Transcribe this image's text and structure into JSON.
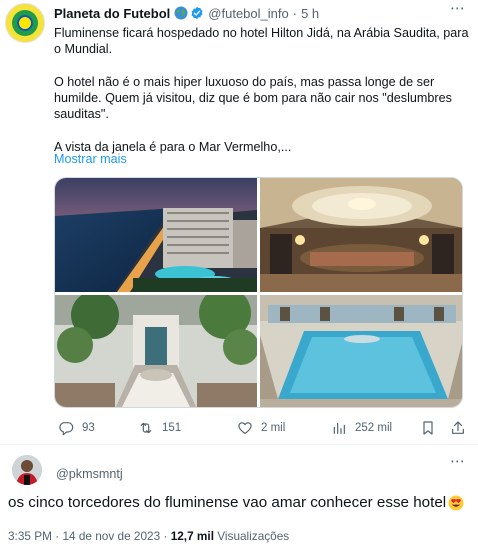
{
  "tweet": {
    "author_name": "Planeta do Futebol",
    "author_handle": "@futebol_info",
    "separator": "·",
    "time": "5 h",
    "paragraphs": [
      "Fluminense ficará hospedado no hotel Hilton Jidá, na Arábia Saudita, para o Mundial.",
      "O hotel não é o mais hiper luxuoso do país, mas passa longe de ser humilde. Quem já visitou, diz que é bom para não cair nos \"deslumbres sauditas\".",
      "A vista da janela é para o Mar Vermelho,..."
    ],
    "show_more": "Mostrar mais",
    "stats": {
      "replies": "93",
      "retweets": "151",
      "likes": "2 mil",
      "views": "252 mil"
    }
  },
  "reply": {
    "handle": "@pkmsmntj",
    "text": "os cinco torcedores do fluminense vao amar conhecer esse hotel",
    "emoji": "smiling-face-with-heart-eyes"
  },
  "meta": {
    "time": "3:35 PM",
    "date": "14 de nov de 2023",
    "views_count": "12,7 mil",
    "views_label": "Visualizações",
    "separator": "·"
  },
  "icons": {
    "verified": "verified-badge-icon",
    "globe": "globe-icon",
    "reply": "reply-icon",
    "retweet": "retweet-icon",
    "like": "heart-icon",
    "views": "views-chart-icon",
    "bookmark": "bookmark-icon",
    "share": "share-icon",
    "more": "more-icon"
  },
  "colors": {
    "text": "#0f1419",
    "secondary": "#536471",
    "link": "#1d9bf0",
    "border": "#cfd9de"
  }
}
